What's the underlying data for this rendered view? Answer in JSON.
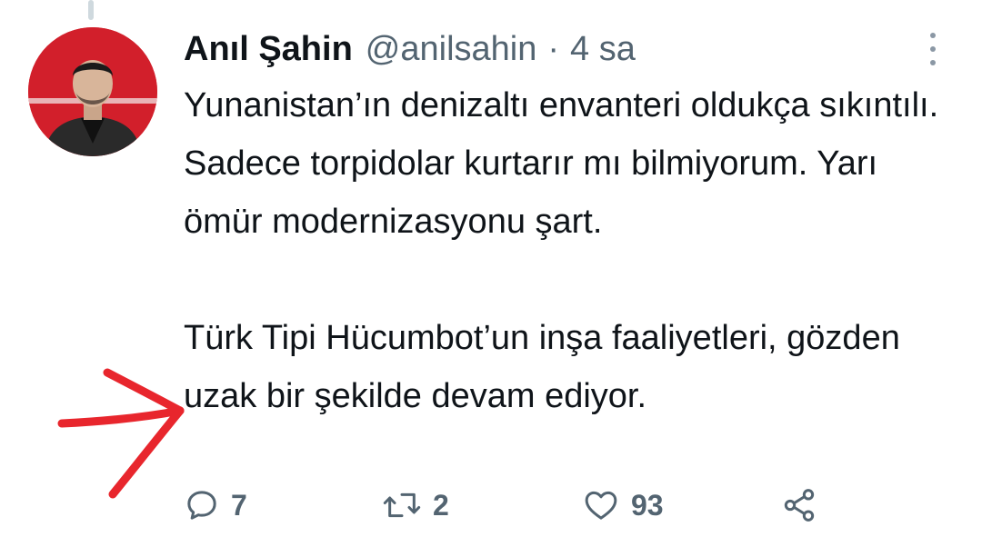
{
  "tweet": {
    "author_name": "Anıl Şahin",
    "handle": "@anilsahin",
    "separator": "·",
    "time": "4 sa",
    "paragraphs": [
      "Yunanistan’ın denizaltı envanteri oldukça sıkıntılı. Sadece torpidolar kurtarır mı bilmiyorum. Yarı ömür modernizasyonu şart.",
      "Türk Tipi Hücumbot’un inşa faaliyetleri, gözden uzak bir şekilde devam ediyor."
    ]
  },
  "actions": {
    "reply_count": "7",
    "retweet_count": "2",
    "like_count": "93"
  },
  "icons": [
    "more-icon",
    "reply-icon",
    "retweet-icon",
    "like-icon",
    "share-icon"
  ],
  "colors": {
    "text": "#0f1419",
    "secondary": "#536471",
    "avatar_background": "#d21f2b",
    "annotation_arrow": "#e8262d"
  }
}
